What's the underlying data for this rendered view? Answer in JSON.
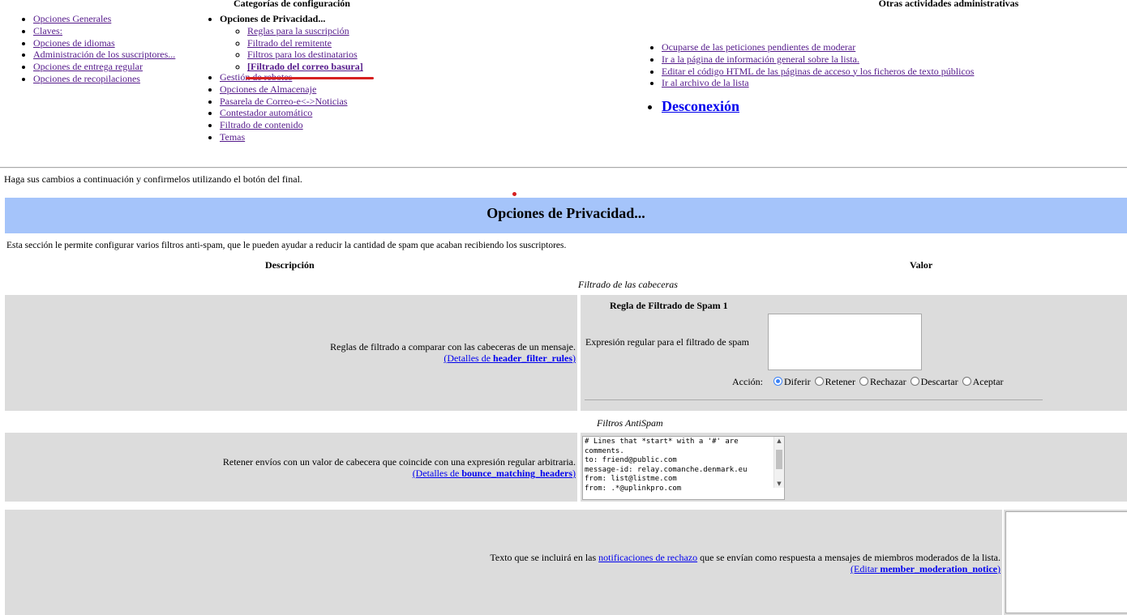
{
  "nav": {
    "categories_heading": "Categorías de configuración",
    "other_heading": "Otras actividades administrativas",
    "col1": [
      "Opciones Generales",
      "Claves:",
      "Opciones de idiomas",
      "Administración de los suscriptores...",
      "Opciones de entrega regular",
      "Opciones de recopilaciones"
    ],
    "privacy_label": "Opciones de Privacidad...",
    "privacy_sub": [
      "Reglas para la suscripción",
      "Filtrado del remitente",
      "Filtros para los destinatarios",
      "[Filtrado del correo basura]"
    ],
    "col2_rest": [
      "Gestión de rebotes",
      "Opciones de Almacenaje",
      "Pasarela de Correo-e<->Noticias",
      "Contestador automático",
      "Filtrado de contenido",
      "Temas"
    ],
    "admin_links": [
      "Ocuparse de las peticiones pendientes de moderar",
      "Ir a la página de información general sobre la lista.",
      "Editar el código HTML de las páginas de acceso y los ficheros de texto públicos",
      "Ir al archivo de la lista"
    ],
    "logout": "Desconexión"
  },
  "instructions": "Haga sus cambios a continuación y confirmelos utilizando el botón del final.",
  "section_title": "Opciones de Privacidad...",
  "section_desc": "Esta sección le permite configurar varios filtros anti-spam, que le pueden ayudar a reducir la cantidad de spam que acaban recibiendo los suscriptores.",
  "table": {
    "col_desc": "Descripción",
    "col_value": "Valor",
    "group1": "Filtrado de las cabeceras",
    "group2": "Filtros AntiSpam"
  },
  "row1": {
    "text": "Reglas de filtrado a comparar con las cabeceras de un mensaje.",
    "details_prefix": "(Detalles de ",
    "details_var": "header_filter_rules",
    "details_suffix": ")",
    "rule_title": "Regla de Filtrado de Spam 1",
    "regex_label": "Expresión regular para el filtrado de spam",
    "regex_value": "",
    "action_label": "Acción:",
    "actions": [
      "Diferir",
      "Retener",
      "Rechazar",
      "Descartar",
      "Aceptar"
    ],
    "selected_action": "Diferir"
  },
  "row2": {
    "text": "Retener envíos con un valor de cabecera que coincide con una expresión regular arbitraria.",
    "details_prefix": "(Detalles de ",
    "details_var": "bounce_matching_headers",
    "details_suffix": ")",
    "textarea_value": "# Lines that *start* with a '#' are\ncomments.\nto: friend@public.com\nmessage-id: relay.comanche.denmark.eu\nfrom: list@listme.com\nfrom: .*@uplinkpro.com"
  },
  "row3": {
    "text_prefix": "Texto que se incluirá en las ",
    "text_link": "notificaciones de rechazo",
    "text_suffix": " que se envían como respuesta a mensajes de miembros moderados de la lista.",
    "edit_prefix": "(Editar ",
    "edit_var": "member_moderation_notice",
    "edit_suffix": ")",
    "textarea_value": ""
  }
}
